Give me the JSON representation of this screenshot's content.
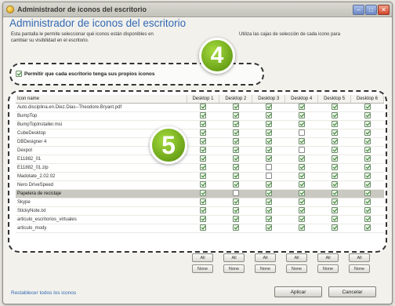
{
  "window": {
    "title": "Administrador de iconos del escritorio",
    "controls": {
      "minimize": "–",
      "maximize": "□",
      "close": "✕"
    }
  },
  "header": {
    "title": "Administrador de iconos del escritorio",
    "description_line1": "Esta pantalla le permite seleccionar qué iconos están disponibles en",
    "description_line1_tail": "Utiliza las cajas de selección de cada icono para",
    "description_line2": "cambiar su visibilidad en el escritorio."
  },
  "option": {
    "label": "Permitir que cada escritorio tenga sus propios iconos",
    "checked": true
  },
  "callouts": {
    "first": "4",
    "second": "5"
  },
  "table": {
    "columns": [
      "Icon name",
      "Desktop 1",
      "Desktop 2",
      "Desktop 3",
      "Desktop 4",
      "Desktop 5",
      "Desktop 6"
    ],
    "rows": [
      {
        "name": "Auto.disciplina.en.Diez.Dias--Theodore.Bryant.pdf",
        "checks": [
          true,
          true,
          true,
          true,
          true,
          true
        ]
      },
      {
        "name": "BumpTop",
        "checks": [
          true,
          true,
          true,
          true,
          true,
          true
        ]
      },
      {
        "name": "BumpTopInstaller.msi",
        "checks": [
          true,
          true,
          true,
          true,
          true,
          true
        ]
      },
      {
        "name": "CubeDesktop",
        "checks": [
          true,
          true,
          true,
          false,
          true,
          true
        ]
      },
      {
        "name": "DBDesigner 4",
        "checks": [
          true,
          true,
          true,
          true,
          true,
          true
        ]
      },
      {
        "name": "Dexpot",
        "checks": [
          true,
          true,
          true,
          false,
          true,
          true
        ]
      },
      {
        "name": "E11882_01",
        "checks": [
          true,
          true,
          true,
          true,
          true,
          true
        ]
      },
      {
        "name": "E11882_01.zip",
        "checks": [
          true,
          true,
          false,
          true,
          true,
          true
        ]
      },
      {
        "name": "Madotate_2.02.02",
        "checks": [
          true,
          true,
          false,
          true,
          true,
          true
        ]
      },
      {
        "name": "Nero DriveSpeed",
        "checks": [
          true,
          true,
          true,
          true,
          true,
          true
        ]
      },
      {
        "name": "Papelera de reciclaje",
        "checks": [
          true,
          false,
          true,
          true,
          true,
          true
        ],
        "selected": true
      },
      {
        "name": "Skype",
        "checks": [
          true,
          true,
          true,
          true,
          true,
          true
        ]
      },
      {
        "name": "StickyNote.txt",
        "checks": [
          true,
          true,
          true,
          true,
          true,
          true
        ]
      },
      {
        "name": "articulo_escritorios_virtuales",
        "checks": [
          true,
          true,
          true,
          true,
          true,
          true
        ]
      },
      {
        "name": "articulo_mody",
        "checks": [
          true,
          true,
          true,
          true,
          true,
          true
        ]
      }
    ]
  },
  "column_buttons": {
    "all": "All",
    "none": "None"
  },
  "footer": {
    "restore_link": "Restablecer todos los iconos",
    "apply": "Aplicar",
    "cancel": "Cancelar"
  },
  "colors": {
    "accent": "#3269b3",
    "callout": "#6ba319",
    "check": "#2b7a2b"
  }
}
